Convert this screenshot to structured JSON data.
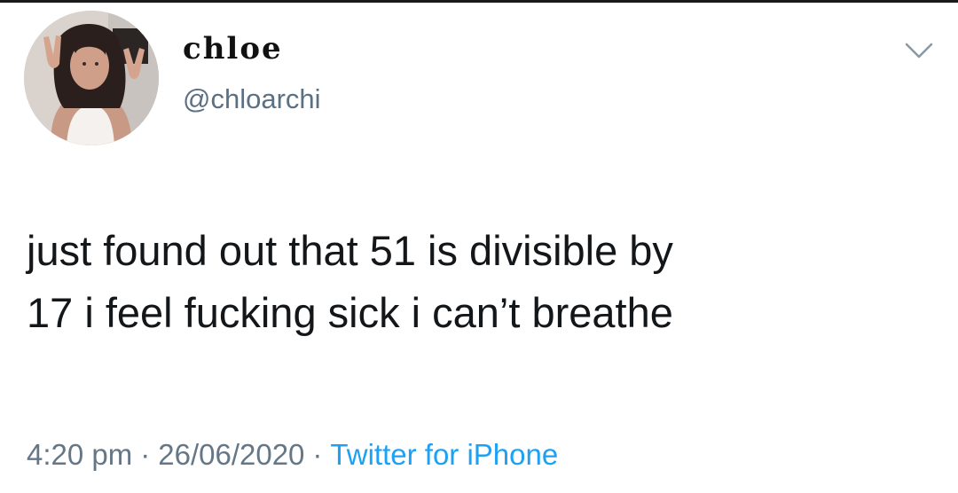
{
  "tweet": {
    "author": {
      "display_name": "chloe",
      "handle": "@chloarchi",
      "avatar_icon": "profile-photo"
    },
    "menu_icon": "chevron-down-icon",
    "text_lines": [
      "just found out that 51 is divisible by",
      "17 i feel fucking sick i can’t breathe"
    ],
    "time": "4:20 pm",
    "separator": "·",
    "date": "26/06/2020",
    "source": "Twitter for iPhone"
  },
  "colors": {
    "text": "#14171a",
    "secondary": "#657786",
    "link": "#1da1f2",
    "background": "#ffffff"
  }
}
